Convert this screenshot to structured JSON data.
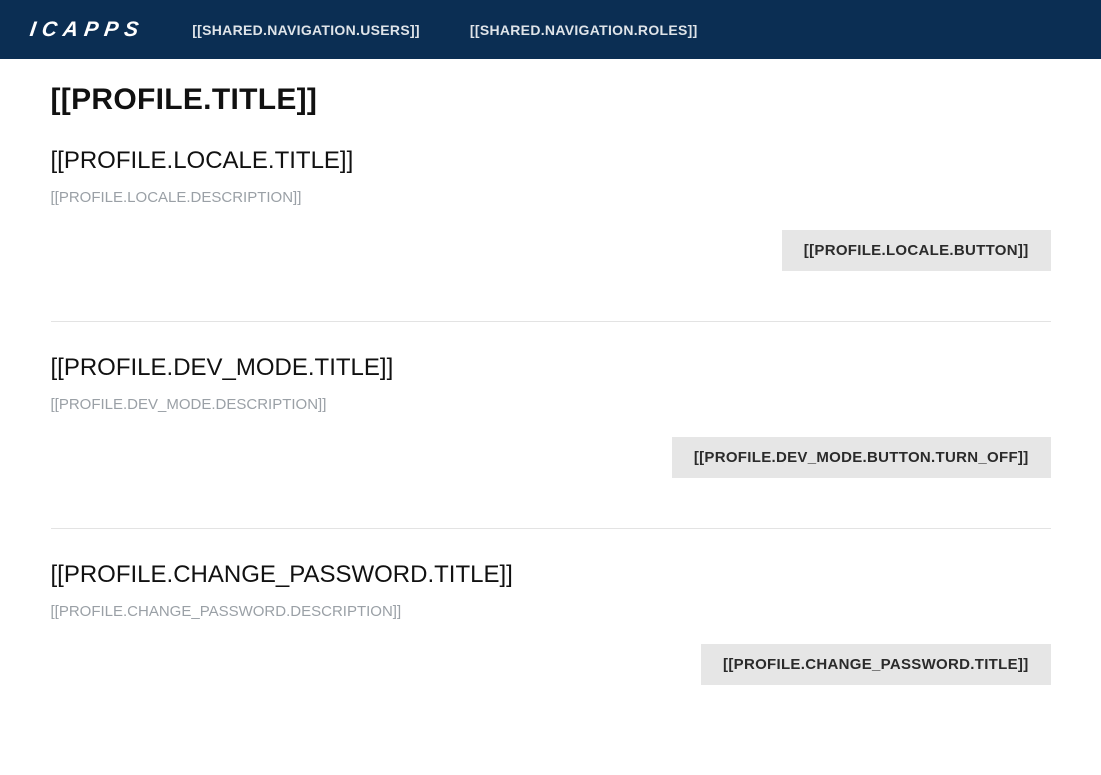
{
  "nav": {
    "logo": "ICAPPS",
    "links": {
      "users": "[[SHARED.NAVIGATION.USERS]]",
      "roles": "[[SHARED.NAVIGATION.ROLES]]"
    }
  },
  "page": {
    "title": "[[PROFILE.TITLE]]",
    "sections": {
      "locale": {
        "title": "[[PROFILE.LOCALE.TITLE]]",
        "description": "[[PROFILE.LOCALE.DESCRIPTION]]",
        "button": "[[PROFILE.LOCALE.BUTTON]]"
      },
      "dev_mode": {
        "title": "[[PROFILE.DEV_MODE.TITLE]]",
        "description": "[[PROFILE.DEV_MODE.DESCRIPTION]]",
        "button": "[[PROFILE.DEV_MODE.BUTTON.TURN_OFF]]"
      },
      "change_password": {
        "title": "[[PROFILE.CHANGE_PASSWORD.TITLE]]",
        "description": "[[PROFILE.CHANGE_PASSWORD.DESCRIPTION]]",
        "button": "[[PROFILE.CHANGE_PASSWORD.TITLE]]"
      }
    }
  }
}
